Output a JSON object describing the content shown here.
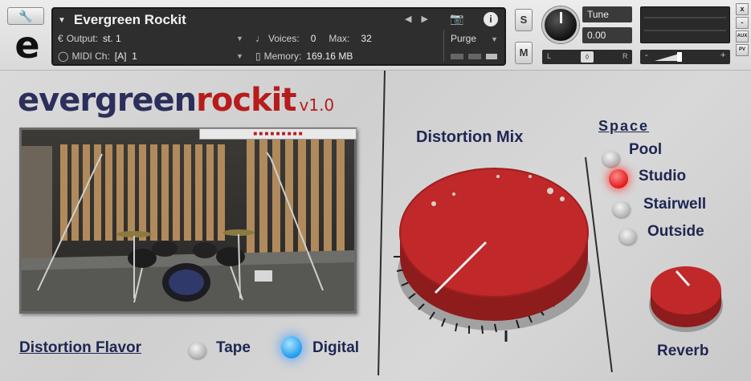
{
  "header": {
    "wrench_icon": "wrench-icon",
    "logo_letter": "e",
    "instrument_name": "Evergreen Rockit",
    "output_label": "Output:",
    "output_value": "st. 1",
    "voices_label": "Voices:",
    "voices_value": "0",
    "max_label": "Max:",
    "max_value": "32",
    "purge_label": "Purge",
    "midi_label": "MIDI Ch:",
    "midi_value": "[A]  1",
    "memory_label": "Memory:",
    "memory_value": "169.16 MB",
    "solo_label": "S",
    "mute_label": "M",
    "tune_label": "Tune",
    "tune_value": "0.00",
    "pan_left": "L",
    "pan_right": "R",
    "vol_minus": "-",
    "vol_plus": "+",
    "side_buttons": [
      "x",
      "-",
      "AUX",
      "PV"
    ]
  },
  "instrument": {
    "logo_part1": "evergreen",
    "logo_part2": "rockit",
    "version": "v1.0",
    "distortion_flavor_label": "Distortion Flavor",
    "flavor_options": [
      {
        "label": "Tape",
        "selected": false
      },
      {
        "label": "Digital",
        "selected": true
      }
    ],
    "distortion_mix_label": "Distortion Mix",
    "space_label": "Space",
    "space_options": [
      {
        "label": "Pool",
        "selected": false
      },
      {
        "label": "Studio",
        "selected": true
      },
      {
        "label": "Stairwell",
        "selected": false
      },
      {
        "label": "Outside",
        "selected": false
      }
    ],
    "reverb_label": "Reverb"
  },
  "colors": {
    "brand_navy": "#2c2f5b",
    "brand_red": "#b71c1c",
    "knob_red": "#c0282a",
    "led_red": "#e31818",
    "led_blue": "#1f9bef"
  }
}
